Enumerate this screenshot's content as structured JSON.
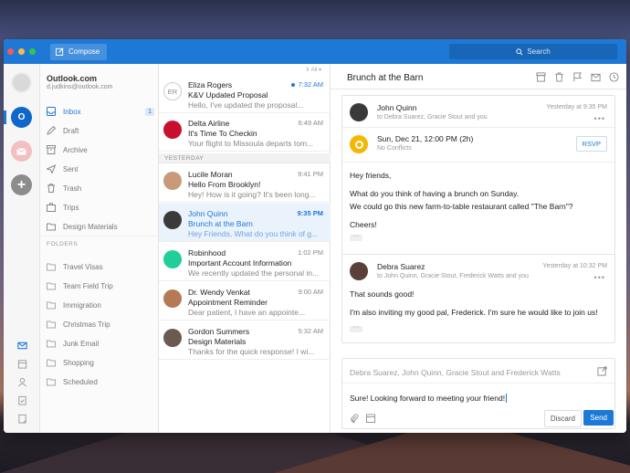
{
  "window": {
    "compose_label": "Compose",
    "search_placeholder": "Search"
  },
  "account": {
    "name": "Outlook.com",
    "email": "d.judkins@outlook.com"
  },
  "folders": {
    "items": [
      {
        "label": "Inbox",
        "icon": "inbox-icon",
        "count": "1",
        "active": true
      },
      {
        "label": "Draft",
        "icon": "draft-icon"
      },
      {
        "label": "Archive",
        "icon": "archive-icon"
      },
      {
        "label": "Sent",
        "icon": "sent-icon"
      },
      {
        "label": "Trash",
        "icon": "trash-icon"
      },
      {
        "label": "Trips",
        "icon": "trips-icon"
      },
      {
        "label": "Design Materials",
        "icon": "folder-icon"
      }
    ],
    "section_label": "FOLDERS",
    "custom": [
      {
        "label": "Travel Visas"
      },
      {
        "label": "Team Field Trip"
      },
      {
        "label": "Immigration"
      },
      {
        "label": "Christmas Trip"
      },
      {
        "label": "Junk Email"
      },
      {
        "label": "Shopping"
      },
      {
        "label": "Scheduled"
      }
    ]
  },
  "list": {
    "filter_label": "All",
    "section_yesterday": "YESTERDAY",
    "messages": [
      {
        "from": "Eliza Rogers",
        "subject": "K&V Updated Proposal",
        "preview": "Hello, I've updated the proposal...",
        "time": "7:32 AM",
        "initials": "ER",
        "unread": true
      },
      {
        "from": "Delta Airline",
        "subject": "It's Time To Checkin",
        "preview": "Your flight to Missoula departs tom...",
        "time": "6:49 AM"
      },
      {
        "from": "Lucile Moran",
        "subject": "Hello From Brooklyn!",
        "preview": "Hey! How is it going? It's been long...",
        "time": "9:41 PM"
      },
      {
        "from": "John Quinn",
        "subject": "Brunch at the Barn",
        "preview": "Hey Friends, What do you think of g...",
        "time": "9:35 PM",
        "selected": true
      },
      {
        "from": "Robinhood",
        "subject": "Important Account Information",
        "preview": "We recently updated the personal in...",
        "time": "1:02 PM"
      },
      {
        "from": "Dr. Wendy Venkat",
        "subject": "Appointment Reminder",
        "preview": "Dear patient, I have an appointe...",
        "time": "9:00 AM"
      },
      {
        "from": "Gordon Summers",
        "subject": "Design Materials",
        "preview": "Thanks for the quick response! I wi...",
        "time": "5:32 AM"
      }
    ]
  },
  "reader": {
    "title": "Brunch at the Barn",
    "message1": {
      "from": "John Quinn",
      "to": "to Debra Suarez, Gracie Stout and you",
      "time": "Yesterday at 9:35 PM",
      "event_when": "Sun, Dec 21, 12:00 PM (2h)",
      "event_conflicts": "No Conflicts",
      "rsvp_label": "RSVP",
      "body": [
        "Hey friends,",
        "What do you think of having a brunch on Sunday.",
        "We could go this new farm-to-table restaurant called \"The Barn\"?",
        "Cheers!"
      ]
    },
    "message2": {
      "from": "Debra Suarez",
      "to": "to John Quinn, Gracie Stout, Frederick Watts and you",
      "time": "Yesterday at 10:32 PM",
      "body": [
        "That sounds good!",
        "I'm also inviting my good pal, Frederick. I'm sure he would like to join us!"
      ]
    },
    "reply": {
      "recipients": "Debra Suarez, John Quinn, Gracie Stout and Frederick Watts",
      "text": "Sure! Looking forward to meeting your friend!",
      "discard_label": "Discard",
      "send_label": "Send"
    }
  },
  "colors": {
    "accent": "#1e79d6",
    "titlebar": "#1e79d6"
  }
}
